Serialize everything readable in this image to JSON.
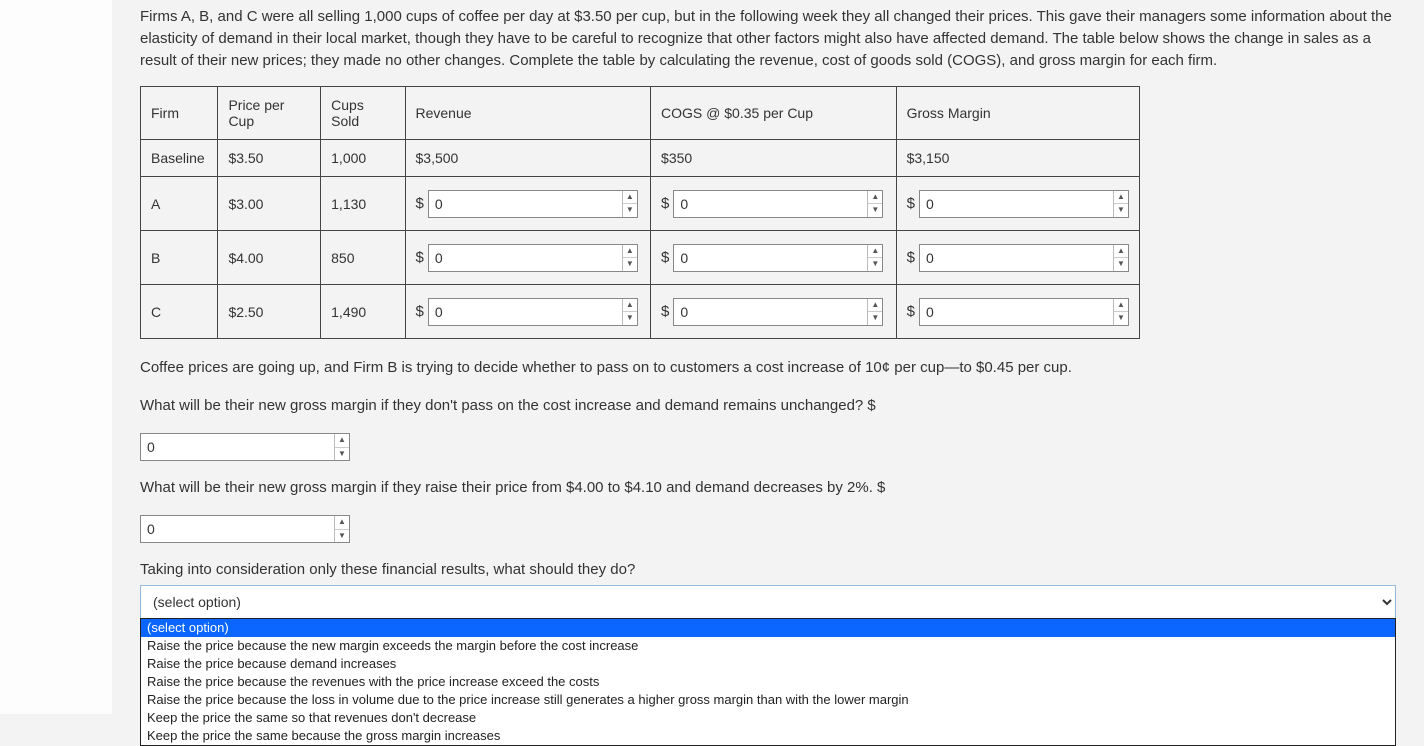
{
  "intro": "Firms A, B, and C were all selling 1,000 cups of coffee per day at $3.50 per cup, but in the following week they all changed their prices. This gave their managers some information about the elasticity of demand in their local market, though they have to be careful to recognize that other factors might also have affected demand. The table below shows the change in sales as a result of their new prices; they made no other changes. Complete the table by calculating the revenue, cost of goods sold (COGS), and gross margin for each firm.",
  "table": {
    "headers": {
      "firm": "Firm",
      "price": "Price per Cup",
      "cups": "Cups Sold",
      "rev": "Revenue",
      "cogs": "COGS @ $0.35 per Cup",
      "gm": "Gross Margin"
    },
    "baseline": {
      "firm": "Baseline",
      "price": "$3.50",
      "cups": "1,000",
      "rev": "$3,500",
      "cogs": "$350",
      "gm": "$3,150"
    },
    "rows": [
      {
        "firm": "A",
        "price": "$3.00",
        "cups": "1,130",
        "rev": "0",
        "cogs": "0",
        "gm": "0"
      },
      {
        "firm": "B",
        "price": "$4.00",
        "cups": "850",
        "rev": "0",
        "cogs": "0",
        "gm": "0"
      },
      {
        "firm": "C",
        "price": "$2.50",
        "cups": "1,490",
        "rev": "0",
        "cogs": "0",
        "gm": "0"
      }
    ]
  },
  "para2": "Coffee prices are going up, and Firm B is trying to decide whether to pass on to customers a cost increase of 10¢ per cup—to $0.45 per cup.",
  "q1": {
    "text": "What will be their new gross margin if they don't pass on the cost increase and demand remains unchanged? $",
    "value": "0"
  },
  "q2": {
    "text": "What will be their new gross margin if they raise their price from $4.00 to $4.10 and demand decreases by 2%. $",
    "value": "0"
  },
  "q3": "Taking into consideration only these financial results, what should they do?",
  "select": {
    "placeholder": "(select option)",
    "options": [
      "(select option)",
      "Raise the price because the new margin exceeds the margin before the cost increase",
      "Raise the price because demand increases",
      "Raise the price because the revenues with the price increase exceed the costs",
      "Raise the price because the loss in volume due to the price increase still generates a higher gross margin than with the lower margin",
      "Keep the price the same so that revenues don't decrease",
      "Keep the price the same because the gross margin increases"
    ]
  }
}
